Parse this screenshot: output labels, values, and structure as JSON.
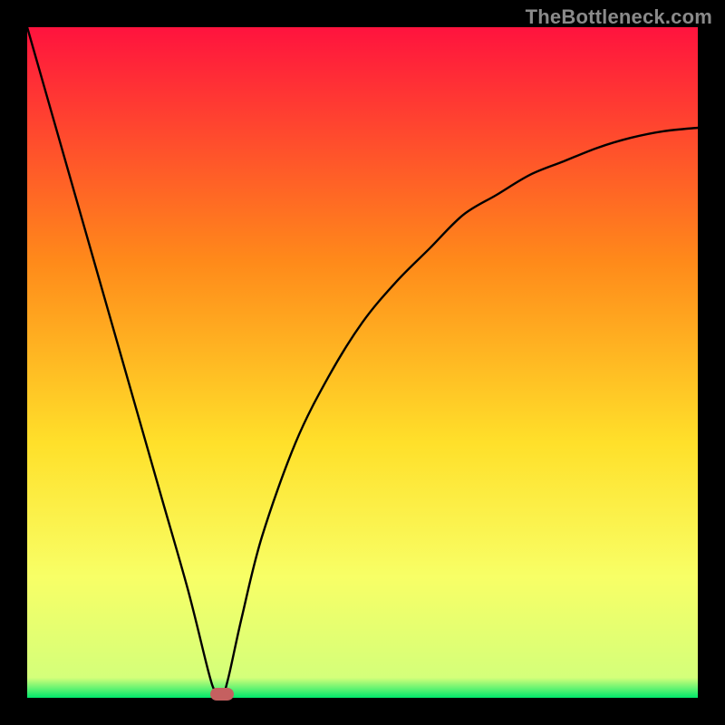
{
  "watermark": {
    "text": "TheBottleneck.com"
  },
  "colors": {
    "gradient_top": "#ff133e",
    "gradient_mid1": "#ff8a1a",
    "gradient_mid2": "#ffe02a",
    "gradient_mid3": "#f8ff66",
    "gradient_bottom": "#00e86b",
    "curve": "#000000",
    "marker_fill": "#c56060",
    "frame_bg": "#000000"
  },
  "chart_data": {
    "type": "line",
    "title": "",
    "xlabel": "",
    "ylabel": "",
    "xlim": [
      0,
      100
    ],
    "ylim": [
      0,
      100
    ],
    "grid": false,
    "legend": false,
    "series": [
      {
        "name": "bottleneck-curve",
        "x": [
          0,
          4,
          8,
          12,
          16,
          20,
          24,
          27,
          28,
          29,
          30,
          32,
          35,
          40,
          45,
          50,
          55,
          60,
          65,
          70,
          75,
          80,
          85,
          90,
          95,
          100
        ],
        "y": [
          100,
          86,
          72,
          58,
          44,
          30,
          16,
          4,
          1,
          0,
          3,
          12,
          24,
          38,
          48,
          56,
          62,
          67,
          72,
          75,
          78,
          80,
          82,
          83.5,
          84.5,
          85
        ]
      }
    ],
    "annotations": [
      {
        "name": "minimum-marker",
        "x": 29,
        "y": 0,
        "shape": "rounded-pill"
      }
    ],
    "background_gradient_stops": [
      {
        "pos": 0.0,
        "color": "#ff133e"
      },
      {
        "pos": 0.35,
        "color": "#ff8a1a"
      },
      {
        "pos": 0.62,
        "color": "#ffe02a"
      },
      {
        "pos": 0.82,
        "color": "#f8ff66"
      },
      {
        "pos": 0.97,
        "color": "#d4ff7a"
      },
      {
        "pos": 1.0,
        "color": "#00e86b"
      }
    ]
  }
}
